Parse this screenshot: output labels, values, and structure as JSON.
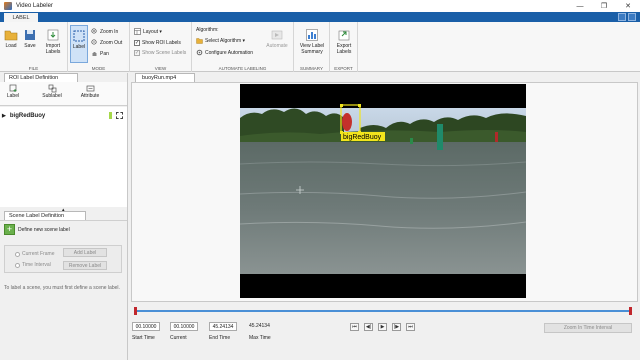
{
  "window": {
    "title": "Video Labeler",
    "controls": [
      "—",
      "❐",
      "✕"
    ]
  },
  "toolstrip": {
    "active_tab": "LABEL"
  },
  "ribbon": {
    "file": {
      "label": "FILE",
      "load": "Load",
      "save": "Save",
      "import": "Import\nLabels"
    },
    "mode": {
      "label": "MODE",
      "label_btn": "Label",
      "zoom_in": "Zoom In",
      "zoom_out": "Zoom Out",
      "pan": "Pan"
    },
    "view": {
      "label": "VIEW",
      "layout": "Layout",
      "show_roi": "Show ROI Labels",
      "show_scene": "Show Scene Labels"
    },
    "automate": {
      "label": "AUTOMATE LABELING",
      "algorithm": "Algorithm:",
      "select_algorithm": "Select Algorithm",
      "configure": "Configure Automation",
      "automate_btn": "Automate"
    },
    "summary": {
      "label": "SUMMARY",
      "view_summary": "View Label\nSummary"
    },
    "export": {
      "label": "EXPORT",
      "export_btn": "Export\nLabels"
    }
  },
  "roi_panel": {
    "tab": "ROI Label Definition",
    "tools": {
      "label": "Label",
      "sublabel": "Sublabel",
      "attribute": "Attribute"
    },
    "items": [
      {
        "name": "bigRedBuoy",
        "color": "#a6d84a"
      }
    ]
  },
  "scene_panel": {
    "tab": "Scene Label Definition",
    "define_new": "Define new scene label",
    "current_frame": "Current Frame",
    "time_interval": "Time Interval",
    "add_label": "Add Label",
    "remove_label": "Remove Label",
    "hint": "To label a scene, you must first define a scene label."
  },
  "document": {
    "tab": "buoyRun.mp4"
  },
  "video": {
    "box_label": "bigRedBuoy",
    "box_color": "#f2e51c"
  },
  "time": {
    "start_value": "00.10000",
    "start_label": "Start Time",
    "current_value": "00.10000",
    "current_label": "Current",
    "end_value": "45.24134",
    "end_label": "End Time",
    "max_value": "45.24134",
    "max_label": "Max Time",
    "zoom_interval": "Zoom In Time Interval"
  },
  "playback": {
    "first": "⏮",
    "prev": "◀|",
    "play": "▶",
    "next": "|▶",
    "last": "⏭"
  }
}
